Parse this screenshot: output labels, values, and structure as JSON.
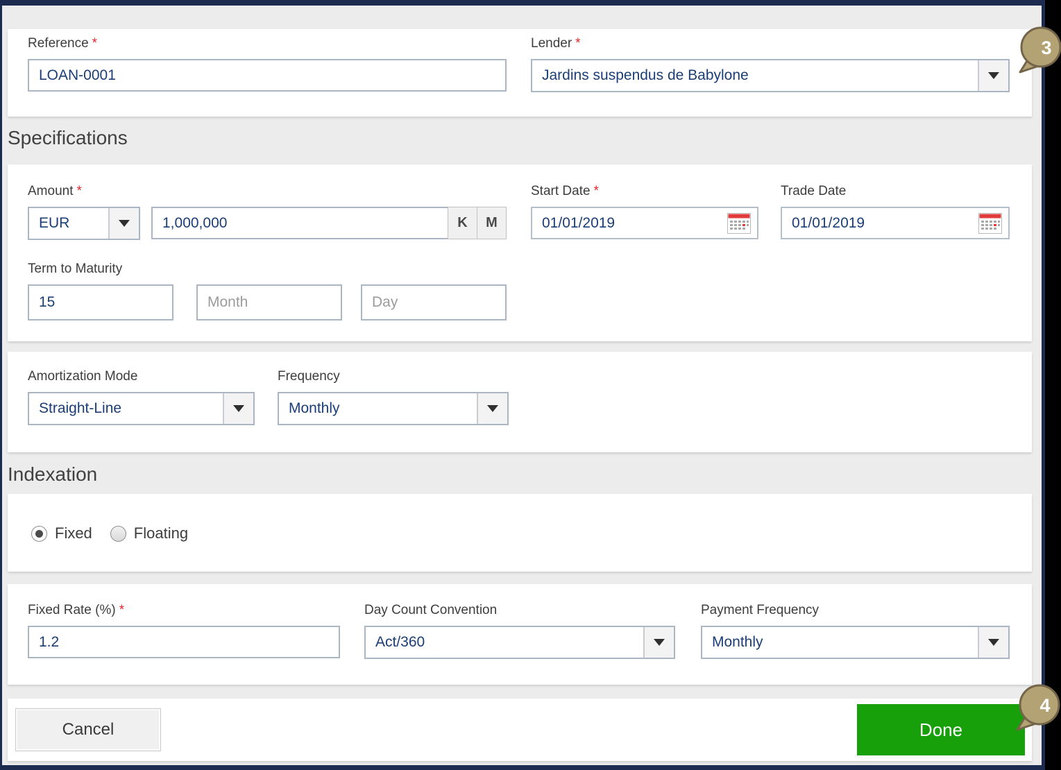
{
  "required_marker": "*",
  "colors": {
    "frame_navy": "#1d2b50",
    "page_bg": "#ececec",
    "value_text_blue": "#1b3e77",
    "required_red": "#e8252a",
    "done_green": "#18a00b",
    "badge_fill": "#b3a273",
    "badge_border": "#74654a"
  },
  "icons": {
    "caret_down": "▼ (css triangle)",
    "calendar": "calendar grid with red header (svg)",
    "radio_selected": "●",
    "radio_unselected": "○"
  },
  "header": {
    "reference": {
      "label": "Reference",
      "required": true,
      "value": "LOAN-0001"
    },
    "lender": {
      "label": "Lender",
      "required": true,
      "value": "Jardins suspendus de Babylone"
    }
  },
  "specifications": {
    "section_title": "Specifications",
    "amount": {
      "label": "Amount",
      "required": true,
      "currency": "EUR",
      "value": "1,000,000",
      "thousand_button": "K",
      "million_button": "M"
    },
    "start_date": {
      "label": "Start Date",
      "required": true,
      "value": "01/01/2019"
    },
    "trade_date": {
      "label": "Trade Date",
      "value": "01/01/2019"
    },
    "term_to_maturity": {
      "label": "Term to Maturity",
      "year_value": "15",
      "month_placeholder": "Month",
      "day_placeholder": "Day"
    },
    "amortization_mode": {
      "label": "Amortization Mode",
      "value": "Straight-Line"
    },
    "frequency": {
      "label": "Frequency",
      "value": "Monthly"
    }
  },
  "indexation": {
    "section_title": "Indexation",
    "type_options": [
      {
        "label": "Fixed",
        "selected": true
      },
      {
        "label": "Floating",
        "selected": false
      }
    ],
    "fixed_rate": {
      "label": "Fixed Rate (%)",
      "required": true,
      "value": "1.2"
    },
    "day_count_convention": {
      "label": "Day Count Convention",
      "value": "Act/360"
    },
    "payment_frequency": {
      "label": "Payment Frequency",
      "value": "Monthly"
    }
  },
  "footer": {
    "cancel_label": "Cancel",
    "done_label": "Done"
  },
  "annotations": {
    "step_3": {
      "number": "3"
    },
    "step_4": {
      "number": "4"
    }
  }
}
